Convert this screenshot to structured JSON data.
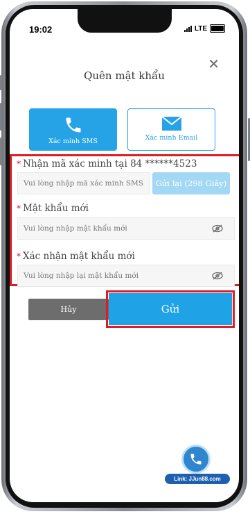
{
  "status": {
    "time": "19:02",
    "network": "LTE"
  },
  "dialog": {
    "title": "Quên mật khẩu",
    "methods": [
      {
        "label": "Xác minh SMS",
        "icon": "phone-icon"
      },
      {
        "label": "Xác minh Email",
        "icon": "envelope-icon"
      }
    ],
    "code_label": "Nhận mã xác minh tại 84 ******4523",
    "code_placeholder": "Vui lòng nhập mã xác minh SMS",
    "resend_label": "Gửi lại (298 Giây)",
    "new_password_label": "Mật khẩu mới",
    "new_password_placeholder": "Vui lòng nhập mật khẩu mới",
    "confirm_password_label": "Xác nhận mật khẩu mới",
    "confirm_password_placeholder": "Vui lòng nhập lại mật khẩu mới",
    "cancel_label": "Hủy",
    "submit_label": "Gửi",
    "required_mark": "*"
  },
  "watermark": {
    "text": "Link: JJun88.com"
  },
  "colors": {
    "accent": "#26a3e6",
    "highlight": "#e11b22",
    "cancel": "#6d6d6d"
  }
}
